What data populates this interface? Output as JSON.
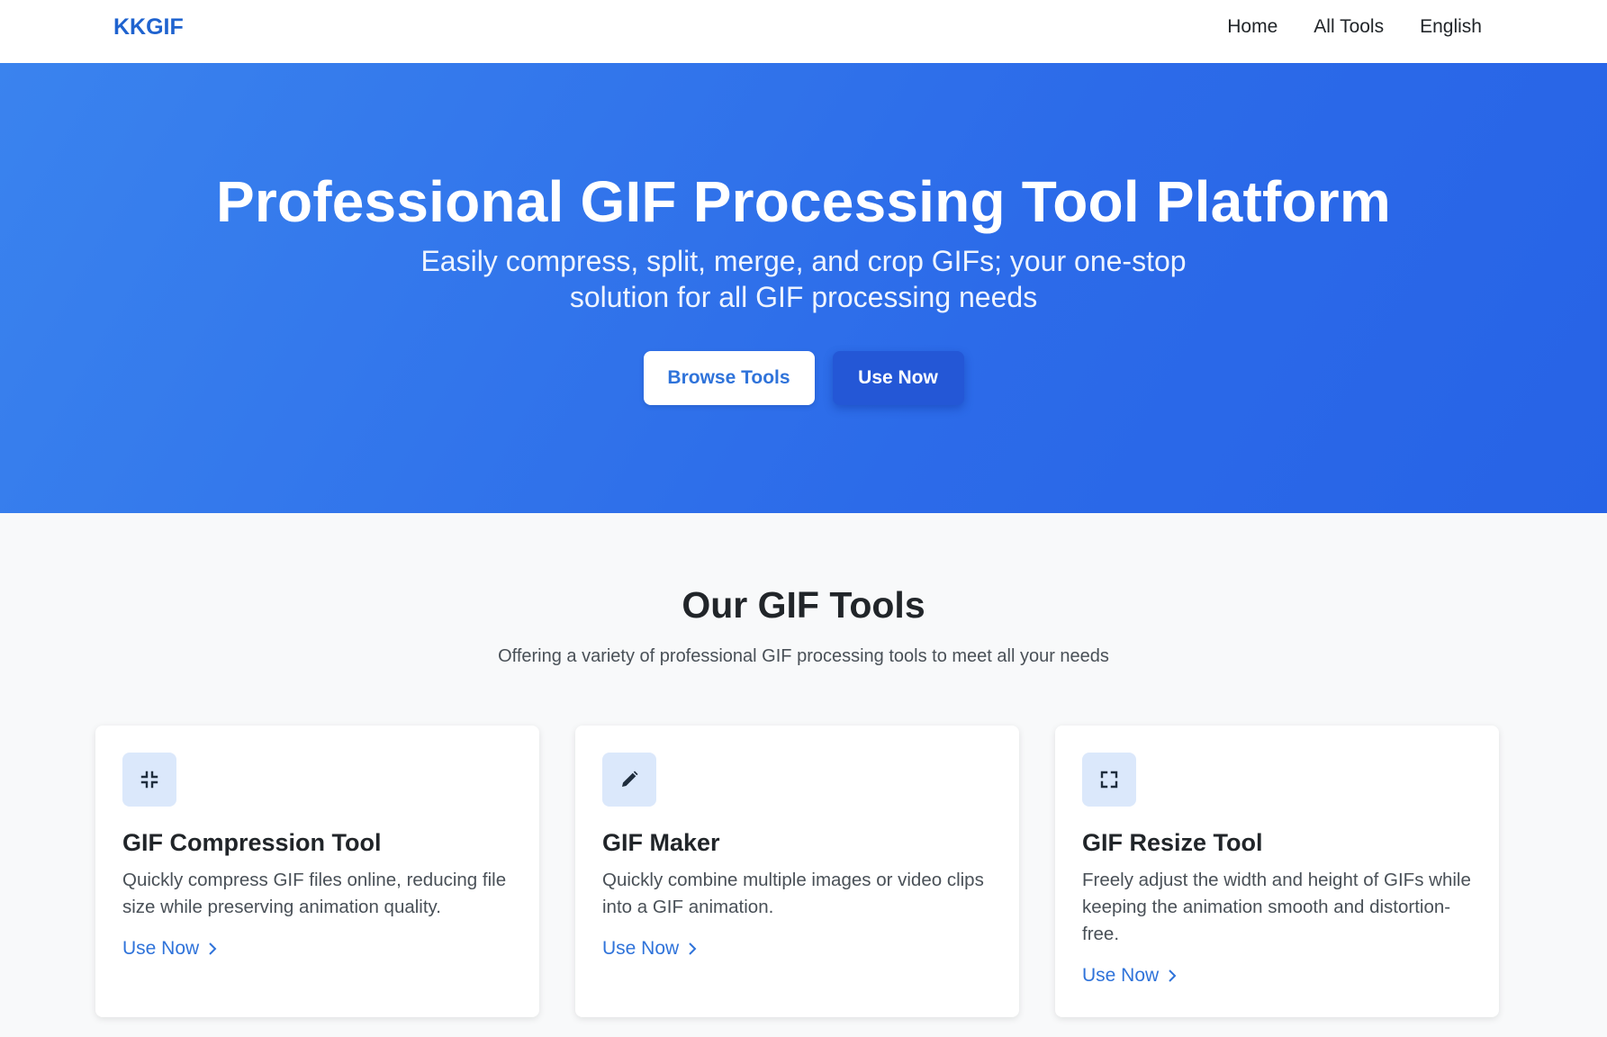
{
  "nav": {
    "brand": "KKGIF",
    "links": [
      "Home",
      "All Tools",
      "English"
    ]
  },
  "hero": {
    "title": "Professional GIF Processing Tool Platform",
    "subtitle": "Easily compress, split, merge, and crop GIFs; your one-stop solution for all GIF processing needs",
    "browse_label": "Browse Tools",
    "use_label": "Use Now"
  },
  "tools": {
    "title": "Our GIF Tools",
    "subtitle": "Offering a variety of professional GIF processing tools to meet all your needs",
    "cards": [
      {
        "icon": "compress-icon",
        "title": "GIF Compression Tool",
        "description": "Quickly compress GIF files online, reducing file size while preserving animation quality.",
        "link": "Use Now"
      },
      {
        "icon": "pencil-icon",
        "title": "GIF Maker",
        "description": "Quickly combine multiple images or video clips into a GIF animation.",
        "link": "Use Now"
      },
      {
        "icon": "resize-icon",
        "title": "GIF Resize Tool",
        "description": "Freely adjust the width and height of GIFs while keeping the animation smooth and distortion-free.",
        "link": "Use Now"
      }
    ]
  },
  "colors": {
    "brand": "#1f63cf",
    "hero_gradient_start": "#3a83ee",
    "hero_gradient_end": "#2763e6",
    "link": "#2f73da",
    "icon_bg": "#dbe8fb"
  }
}
